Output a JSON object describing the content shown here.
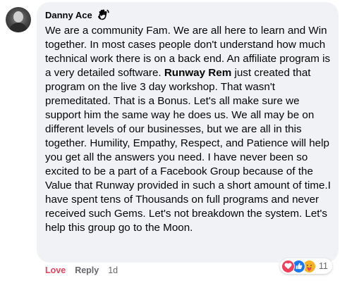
{
  "comment": {
    "author": "Danny Ace",
    "badge_icon": "wave-hand-icon",
    "text_part1": "We are a community Fam. We are all here to learn and Win together. In most cases people don't understand how much technical work there is on a back end. An affiliate program is a very detailed software. ",
    "text_bold": "Runway Rem",
    "text_part2": " just created that program on the live 3 day workshop. That wasn't premeditated. That is a Bonus. Let's all make sure we support him the same way he does us. We all may be on different levels of our businesses, but we are all in this together. Humility, Empathy, Respect, and Patience will help you get all the answers you need. I have never been so excited to be a part of a Facebook Group because of the Value that Runway provided in such a short amount of time.I have spent tens of Thousands on full programs and never received such Gems. Let's not breakdown the system. Let's help this group go to the Moon."
  },
  "actions": {
    "love_label": "Love",
    "reply_label": "Reply",
    "timestamp": "1d"
  },
  "reactions": {
    "icons": [
      "heart-icon",
      "thumbs-up-icon",
      "care-icon"
    ],
    "count": "11"
  },
  "colors": {
    "bubble_bg": "#f0f2f5",
    "love_red": "#f33e58",
    "like_blue": "#1877f2",
    "care_yellow": "#f7b125",
    "secondary_text": "#65676b"
  }
}
